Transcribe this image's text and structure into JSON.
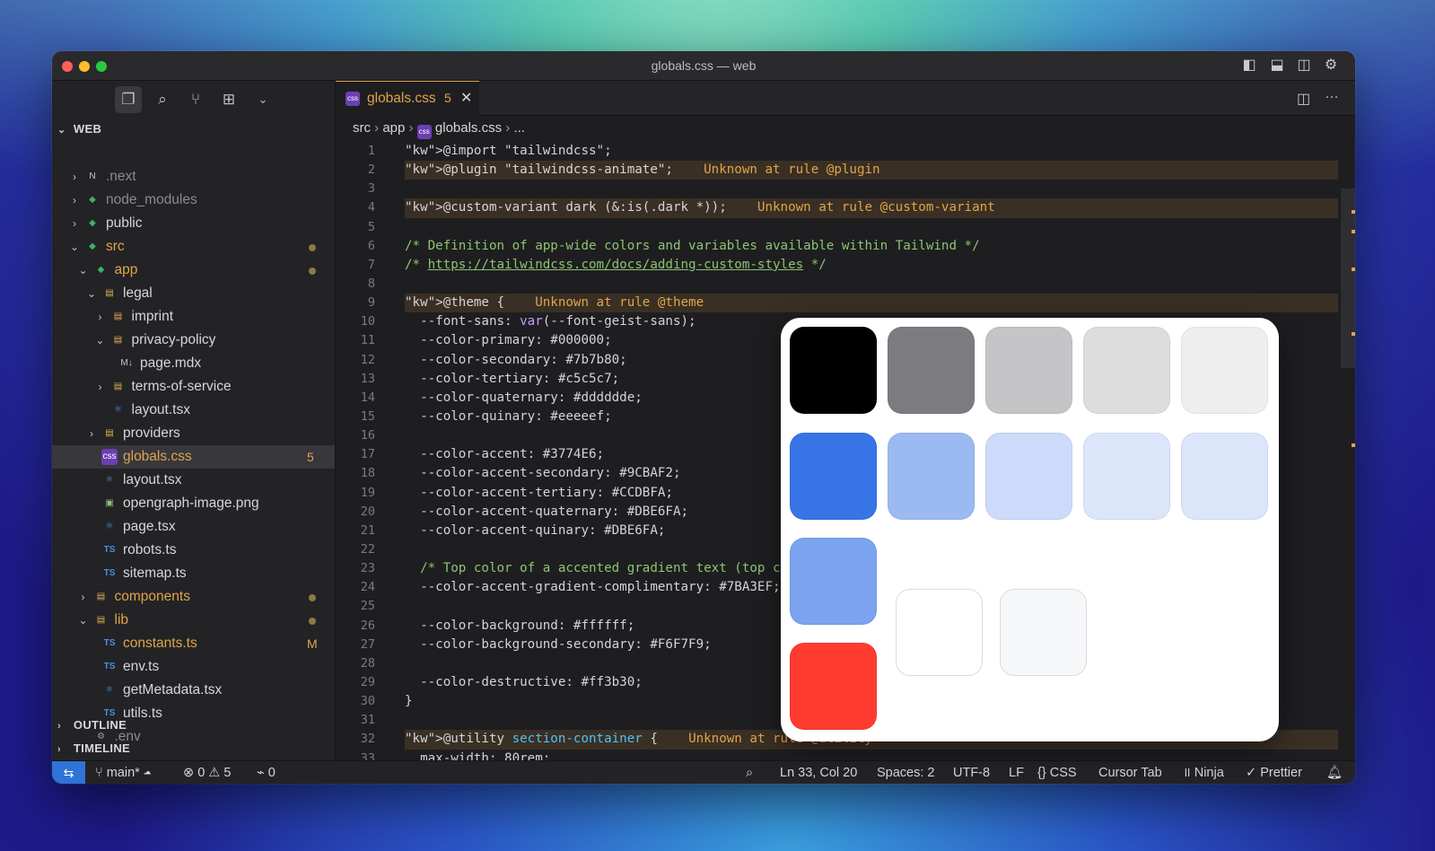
{
  "window": {
    "title": "globals.css — web"
  },
  "activity": {
    "icons": [
      "explorer-icon",
      "search-icon",
      "source-control-icon",
      "extensions-icon",
      "chevron-down-icon"
    ]
  },
  "explorer": {
    "root_label": "WEB",
    "items": [
      {
        "label": ".next",
        "icon": "N",
        "color": "#8a8a90",
        "dim": true
      },
      {
        "label": "node_modules",
        "icon": "◆",
        "color": "#8a8a90",
        "dim": true
      },
      {
        "label": "public",
        "icon": "◆",
        "color": "#d6d6da"
      },
      {
        "label": "src",
        "icon": "◆",
        "color": "#e0a44a"
      },
      {
        "label": "app",
        "icon": "◆",
        "color": "#e0a44a"
      },
      {
        "label": "legal",
        "icon": "▤",
        "color": "#d6d6da"
      },
      {
        "label": "imprint",
        "icon": "▤",
        "color": "#d6d6da"
      },
      {
        "label": "privacy-policy",
        "icon": "▤",
        "color": "#d6d6da"
      },
      {
        "label": "page.mdx",
        "icon": "M↓",
        "color": "#d6d6da"
      },
      {
        "label": "terms-of-service",
        "icon": "▤",
        "color": "#d6d6da"
      },
      {
        "label": "layout.tsx",
        "icon": "⚛",
        "color": "#d6d6da"
      },
      {
        "label": "providers",
        "icon": "▤",
        "color": "#d6d6da"
      },
      {
        "label": "globals.css",
        "icon": "css",
        "color": "#e0a44a",
        "badge": "5"
      },
      {
        "label": "layout.tsx",
        "icon": "⚛",
        "color": "#d6d6da"
      },
      {
        "label": "opengraph-image.png",
        "icon": "▣",
        "color": "#d6d6da"
      },
      {
        "label": "page.tsx",
        "icon": "⚛",
        "color": "#d6d6da"
      },
      {
        "label": "robots.ts",
        "icon": "TS",
        "color": "#d6d6da"
      },
      {
        "label": "sitemap.ts",
        "icon": "TS",
        "color": "#d6d6da"
      },
      {
        "label": "components",
        "icon": "▤",
        "color": "#e0a44a"
      },
      {
        "label": "lib",
        "icon": "▤",
        "color": "#e0a44a"
      },
      {
        "label": "constants.ts",
        "icon": "TS",
        "color": "#e0a44a",
        "badge": "M"
      },
      {
        "label": "env.ts",
        "icon": "TS",
        "color": "#d6d6da"
      },
      {
        "label": "getMetadata.tsx",
        "icon": "⚛",
        "color": "#d6d6da"
      },
      {
        "label": "utils.ts",
        "icon": "TS",
        "color": "#d6d6da"
      },
      {
        "label": ".env",
        "icon": "⚙",
        "color": "#8a8a90",
        "dim": true
      }
    ],
    "outline_label": "OUTLINE",
    "timeline_label": "TIMELINE"
  },
  "tab": {
    "label": "globals.css",
    "problems": "5",
    "icon": "css"
  },
  "breadcrumb": {
    "parts": [
      "src",
      "app",
      "globals.css",
      "..."
    ]
  },
  "code": {
    "lines": [
      "@import \"tailwindcss\";",
      "@plugin \"tailwindcss-animate\";",
      "",
      "@custom-variant dark (&:is(.dark *));",
      "",
      "/* Definition of app-wide colors and variables available within Tailwind */",
      "/* https://tailwindcss.com/docs/adding-custom-styles */",
      "",
      "@theme {",
      "  --font-sans: var(--font-geist-sans);",
      "  --color-primary: #000000;",
      "  --color-secondary: #7b7b80;",
      "  --color-tertiary: #c5c5c7;",
      "  --color-quaternary: #dddddde;",
      "  --color-quinary: #eeeeef;",
      "",
      "  --color-accent: #3774E6;",
      "  --color-accent-secondary: #9CBAF2;",
      "  --color-accent-tertiary: #CCDBFA;",
      "  --color-accent-quaternary: #DBE6FA;",
      "  --color-accent-quinary: #DBE6FA;",
      "",
      "  /* Top color of a accented gradient text (top c",
      "  --color-accent-gradient-complimentary: #7BA3EF;",
      "",
      "  --color-background: #ffffff;",
      "  --color-background-secondary: #F6F7F9;",
      "",
      "  --color-destructive: #ff3b30;",
      "}",
      "",
      "@utility section-container {",
      "  max-width: 80rem;"
    ],
    "warnings": {
      "2": "Unknown at rule @plugin",
      "4": "Unknown at rule @custom-variant",
      "9": "Unknown at rule @theme",
      "32": "Unknown at rule @utility"
    }
  },
  "swatches": {
    "row1": [
      "#000000",
      "#7b7b80",
      "#c5c5c7",
      "#dddddd",
      "#eeeeef"
    ],
    "row2": [
      "#3774E6",
      "#9CBAF2",
      "#CCDBFA",
      "#DBE6FA",
      "#DBE6FA"
    ],
    "row3": [
      "#7BA3EF"
    ],
    "row4": [
      "#ff3b30"
    ],
    "background": [
      "#ffffff",
      "#F6F7F9"
    ]
  },
  "status": {
    "branch": "main*",
    "errors": "0",
    "warnings": "5",
    "ports": "0",
    "position": "Ln 33, Col 20",
    "spaces": "Spaces: 2",
    "encoding": "UTF-8",
    "eol": "LF",
    "language": "CSS",
    "cursor_tab": "Cursor Tab",
    "ninja": "Ninja",
    "prettier": "Prettier"
  }
}
